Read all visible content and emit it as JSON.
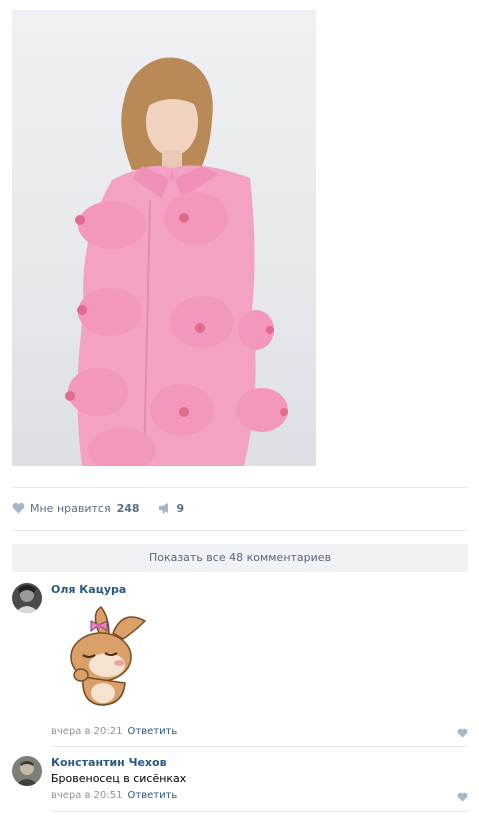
{
  "post": {
    "image_alt": "Photo of a person in a pink coat",
    "likes_label": "Мне нравится",
    "likes_count": "248",
    "shares_count": "9"
  },
  "comments_section": {
    "show_all_label": "Показать все 48 комментариев"
  },
  "comments": [
    {
      "author": "Оля Кацура",
      "attachment": "sticker",
      "time": "вчера в 20:21",
      "reply_label": "Ответить"
    },
    {
      "author": "Константин Чехов",
      "text": "Бровеносец в сисёнках",
      "time": "вчера в 20:51",
      "reply_label": "Ответить"
    }
  ],
  "colors": {
    "link": "#2a5885",
    "muted": "#939393",
    "action": "#5b6f84",
    "icon": "#a5b6c9",
    "show_all_bg": "#f0f2f5"
  },
  "icons": [
    "heart-icon",
    "megaphone-icon"
  ]
}
